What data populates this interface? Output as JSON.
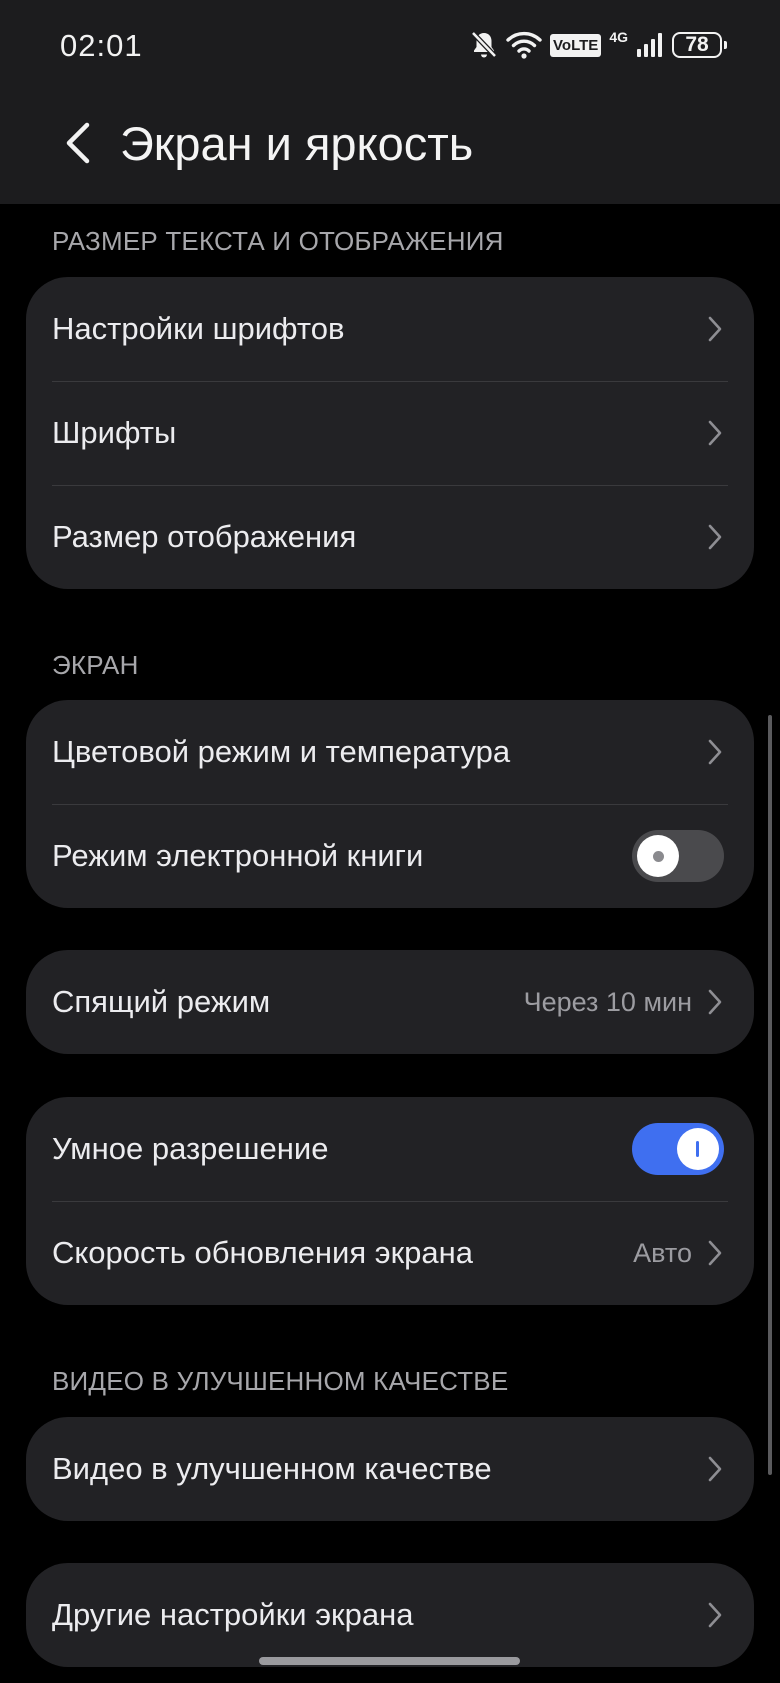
{
  "status_bar": {
    "time": "02:01",
    "volte": "VoLTE",
    "network": "4G",
    "battery": "78"
  },
  "header": {
    "title": "Экран и яркость"
  },
  "sections": {
    "text_size": {
      "title": "РАЗМЕР ТЕКСТА И ОТОБРАЖЕНИЯ",
      "items": [
        {
          "label": "Настройки шрифтов"
        },
        {
          "label": "Шрифты"
        },
        {
          "label": "Размер отображения"
        }
      ]
    },
    "screen": {
      "title": "ЭКРАН",
      "items": [
        {
          "label": "Цветовой режим и температура"
        },
        {
          "label": "Режим электронной книги",
          "toggle": "off"
        }
      ]
    },
    "sleep": {
      "items": [
        {
          "label": "Спящий режим",
          "value": "Через 10 мин"
        }
      ]
    },
    "resolution": {
      "items": [
        {
          "label": "Умное разрешение",
          "toggle": "on"
        },
        {
          "label": "Скорость обновления экрана",
          "value": "Авто"
        }
      ]
    },
    "video": {
      "title": "ВИДЕО В УЛУЧШЕННОМ КАЧЕСТВЕ",
      "items": [
        {
          "label": "Видео в улучшенном качестве"
        }
      ]
    },
    "other": {
      "items": [
        {
          "label": "Другие настройки экрана"
        }
      ]
    }
  },
  "colors": {
    "background": "#000000",
    "card": "#222225",
    "accent": "#3f6ff0",
    "secondary_text": "#a7a7ab"
  }
}
